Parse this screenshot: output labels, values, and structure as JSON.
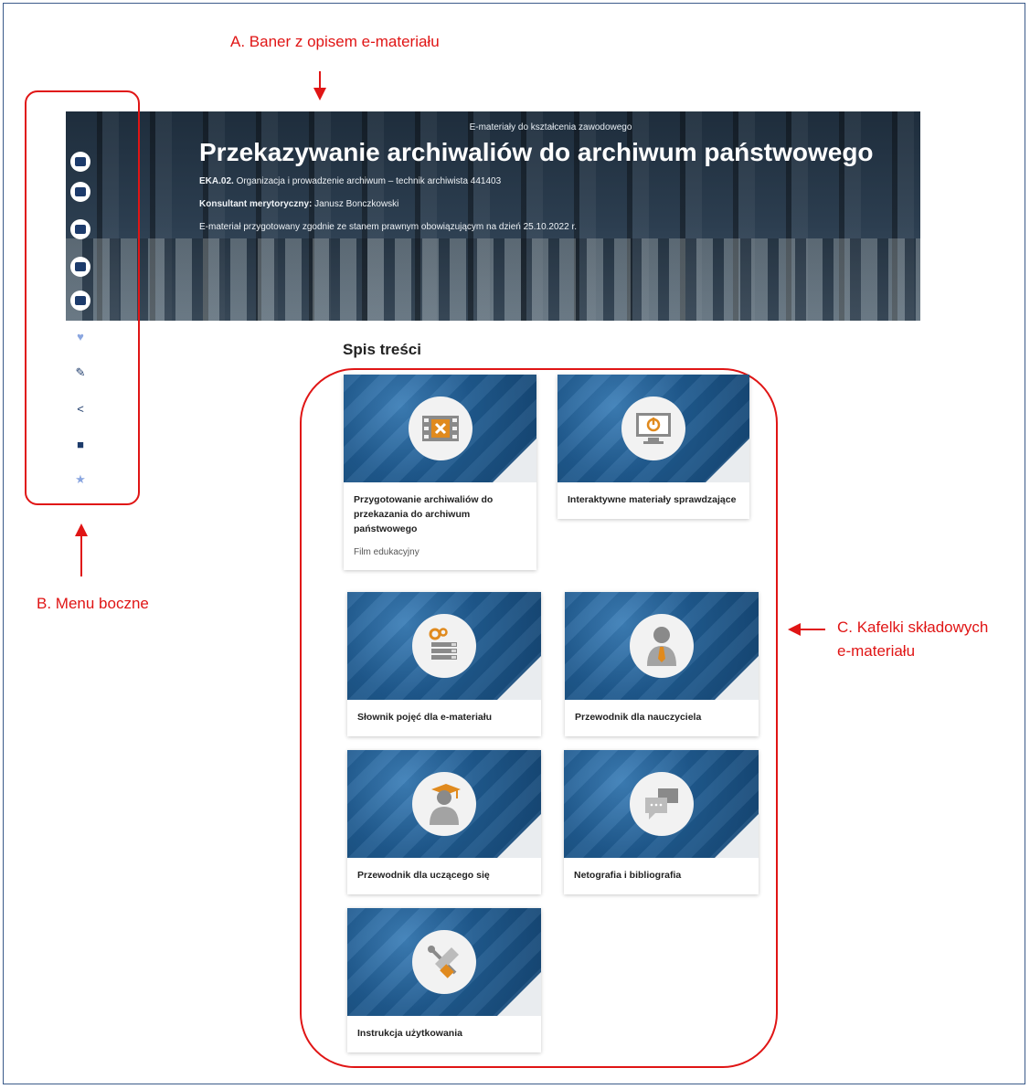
{
  "annotations": {
    "a_label": "A. Baner z opisem e-materiału",
    "b_label": "B. Menu boczne",
    "c_label_line1": "C. Kafelki składowych",
    "c_label_line2": "e-materiału"
  },
  "banner": {
    "kicker": "E-materiały do kształcenia zawodowego",
    "title": "Przekazywanie archiwaliów do archiwum państwowego",
    "qualification_code": "EKA.02.",
    "qualification_text": " Organizacja i prowadzenie archiwum – technik archiwista 441403",
    "consultant_label": "Konsultant merytoryczny:",
    "consultant_name": " Janusz Bonczkowski",
    "legal_note": "E-materiał przygotowany zgodnie ze stanem prawnym obowiązującym na dzień 25.10.2022 r."
  },
  "side_menu": {
    "icons": [
      "book-icon",
      "print-icon",
      "image-icon",
      "gallery-icon",
      "slides-icon",
      "heart-icon",
      "pen-icon",
      "share-icon",
      "puzzle-icon",
      "star-icon"
    ]
  },
  "toc": {
    "title": "Spis treści",
    "tiles": [
      {
        "label": "Przygotowanie archiwaliów do przekazania do archiwum państwowego",
        "sublabel": "Film edukacyjny",
        "icon": "film-icon"
      },
      {
        "label": "Interaktywne materiały sprawdzające",
        "icon": "monitor-power-icon"
      },
      {
        "label": "Słownik pojęć dla e-materiału",
        "icon": "books-gear-icon"
      },
      {
        "label": "Przewodnik dla nauczyciela",
        "icon": "teacher-icon"
      },
      {
        "label": "Przewodnik dla uczącego się",
        "icon": "student-icon"
      },
      {
        "label": "Netografia i bibliografia",
        "icon": "chat-icon"
      },
      {
        "label": "Instrukcja użytkowania",
        "icon": "tools-icon"
      }
    ]
  },
  "colors": {
    "annotation": "#e01515",
    "menu_icon": "#1d3b6b",
    "tile_blue": "#1f5a8f",
    "accent_orange": "#e08a1e"
  }
}
